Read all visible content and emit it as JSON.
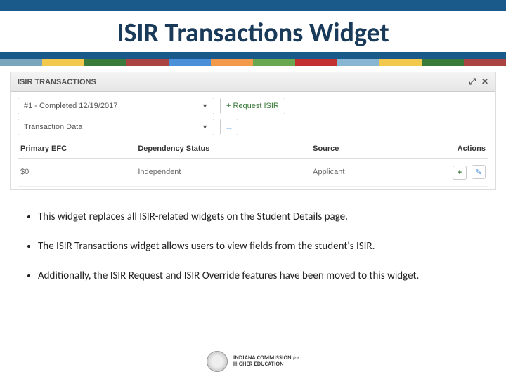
{
  "title": "ISIR Transactions Widget",
  "widget": {
    "header": "ISIR TRANSACTIONS",
    "select_value": "#1 - Completed 12/19/2017",
    "request_label": "Request ISIR",
    "transaction_label": "Transaction Data",
    "columns": {
      "c1": "Primary EFC",
      "c2": "Dependency Status",
      "c3": "Source",
      "c4": "Actions"
    },
    "row": {
      "efc": "$0",
      "dep": "Independent",
      "src": "Applicant"
    }
  },
  "bullets": {
    "b1": "This widget replaces all ISIR-related widgets on the Student Details page.",
    "b2": "The ISIR Transactions widget allows users to view fields from the student's ISIR.",
    "b3": "Additionally, the ISIR Request and ISIR Override features have been moved to this widget."
  },
  "footer": {
    "line1": "INDIANA COMMISSION",
    "for": "for",
    "line2": "HIGHER EDUCATION"
  }
}
